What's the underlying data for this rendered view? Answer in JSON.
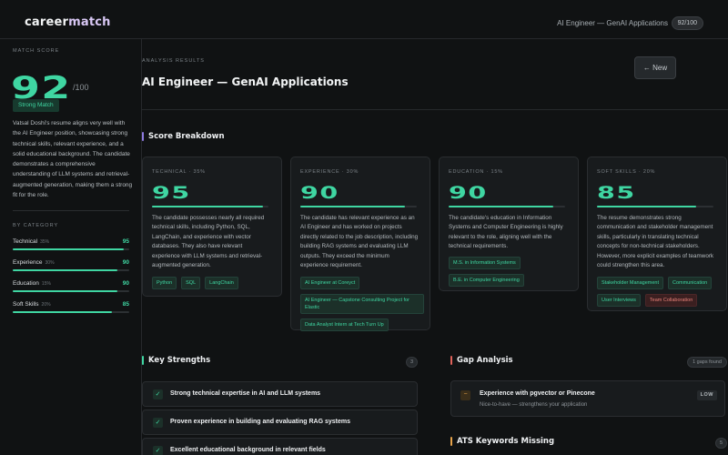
{
  "header": {
    "logo_part1": "career",
    "logo_part2": "match",
    "job_title": "AI Engineer — GenAI Applications",
    "score_badge": "92/100"
  },
  "sidebar": {
    "match_score_label": "MATCH SCORE",
    "score": "92",
    "score_denominator": "/100",
    "match_label": "Strong Match",
    "summary": "Vatsal Doshi's resume aligns very well with the AI Engineer position, showcasing strong technical skills, relevant experience, and a solid educational background. The candidate demonstrates a comprehensive understanding of LLM systems and retrieval-augmented generation, making them a strong fit for the role.",
    "by_category_label": "BY CATEGORY",
    "categories": [
      {
        "name": "Technical",
        "weight": "35%",
        "score": "95",
        "fill": 0.95
      },
      {
        "name": "Experience",
        "weight": "30%",
        "score": "90",
        "fill": 0.9
      },
      {
        "name": "Education",
        "weight": "15%",
        "score": "90",
        "fill": 0.9
      },
      {
        "name": "Soft Skills",
        "weight": "20%",
        "score": "85",
        "fill": 0.85
      }
    ]
  },
  "main": {
    "eyebrow": "ANALYSIS RESULTS",
    "title": "AI Engineer — GenAI Applications",
    "new_button": "← New",
    "breakdown_title": "Score Breakdown",
    "cards": [
      {
        "category": "TECHNICAL · 35%",
        "score": "95",
        "fill": 0.95,
        "description": "The candidate possesses nearly all required technical skills, including Python, SQL, LangChain, and experience with vector databases. They also have relevant experience with LLM systems and retrieval-augmented generation.",
        "tags": [
          {
            "text": "Python",
            "style": "green"
          },
          {
            "text": "SQL",
            "style": "green"
          },
          {
            "text": "LangChain",
            "style": "green"
          }
        ]
      },
      {
        "category": "EXPERIENCE · 30%",
        "score": "90",
        "fill": 0.9,
        "description": "The candidate has relevant experience as an AI Engineer and has worked on projects directly related to the job description, including building RAG systems and evaluating LLM outputs. They exceed the minimum experience requirement.",
        "tags": [
          {
            "text": "AI Engineer at Coreyct",
            "style": "green"
          },
          {
            "text": "AI Engineer — Capstone Consulting Project for Elastic",
            "style": "green"
          },
          {
            "text": "Data Analyst Intern at Tech Turn Up",
            "style": "green"
          }
        ]
      },
      {
        "category": "EDUCATION · 15%",
        "score": "90",
        "fill": 0.9,
        "description": "The candidate's education in Information Systems and Computer Engineering is highly relevant to the role, aligning well with the technical requirements.",
        "tags": [
          {
            "text": "M.S. in Information Systems",
            "style": "green"
          },
          {
            "text": "B.E. in Computer Engineering",
            "style": "green"
          }
        ]
      },
      {
        "category": "SOFT SKILLS · 20%",
        "score": "85",
        "fill": 0.85,
        "description": "The resume demonstrates strong communication and stakeholder management skills, particularly in translating technical concepts for non-technical stakeholders. However, more explicit examples of teamwork could strengthen this area.",
        "tags": [
          {
            "text": "Stakeholder Management",
            "style": "green"
          },
          {
            "text": "Communication",
            "style": "green"
          },
          {
            "text": "User Interviews",
            "style": "green"
          },
          {
            "text": "Team Collaboration",
            "style": "red"
          }
        ]
      }
    ],
    "strengths_title": "Key Strengths",
    "strengths_count": "3",
    "strengths": [
      "Strong technical expertise in AI and LLM systems",
      "Proven experience in building and evaluating RAG systems",
      "Excellent educational background in relevant fields"
    ],
    "gap_title": "Gap Analysis",
    "gap_count": "1 gaps found",
    "gaps": [
      {
        "icon": "−",
        "title": "Experience with pgvector or Pinecone",
        "subtitle": "Nice-to-have — strengthens your application",
        "severity": "LOW"
      }
    ],
    "ats_title": "ATS Keywords Missing",
    "ats_count": "5"
  },
  "colors": {
    "accent": "#3fd6a2",
    "background": "#101213",
    "card": "#181b1d"
  }
}
